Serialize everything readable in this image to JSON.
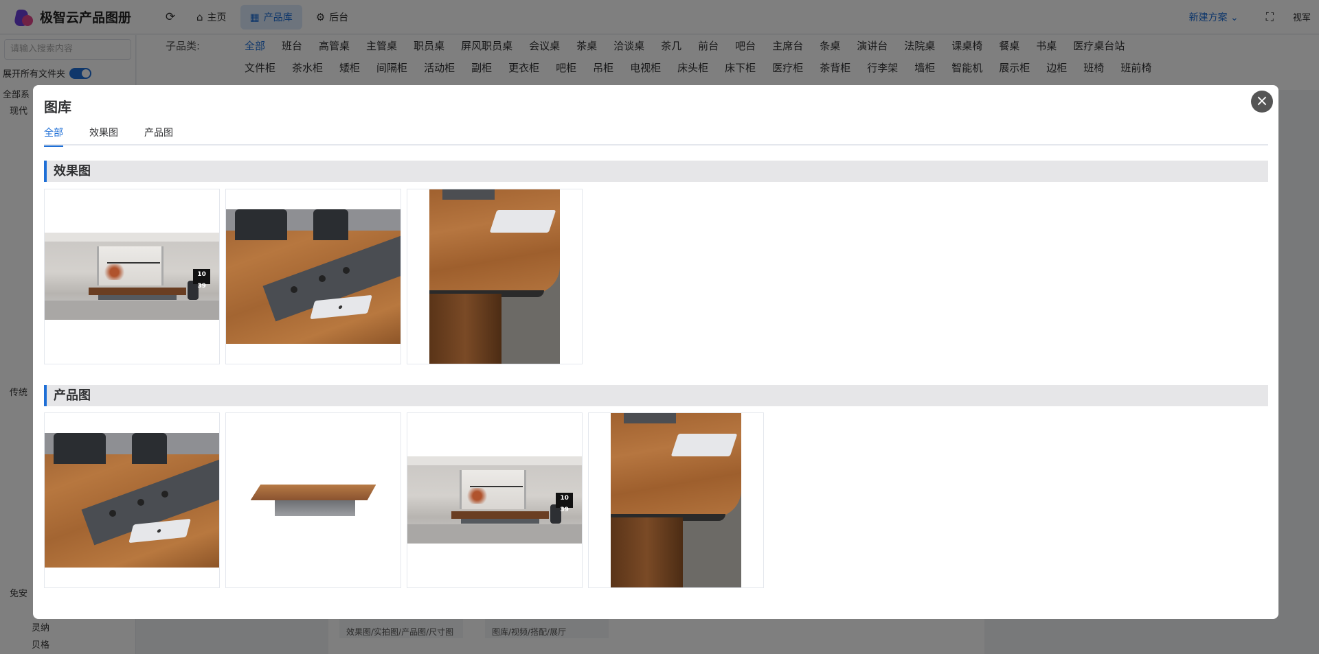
{
  "app": {
    "name": "极智云产品图册",
    "nav": {
      "home": "主页",
      "library": "产品库",
      "backend": "后台"
    },
    "new_plan": "新建方案",
    "user": "视军"
  },
  "sidebar": {
    "search_placeholder": "请输入搜索内容",
    "expand_label": "展开所有文件夹",
    "items": [
      "全部系",
      "现代",
      "传统",
      "免安",
      "灵纳",
      "贝格"
    ]
  },
  "filters": {
    "label": "子品类:",
    "row1": [
      "全部",
      "班台",
      "高管桌",
      "主管桌",
      "职员桌",
      "屏风职员桌",
      "会议桌",
      "茶桌",
      "洽谈桌",
      "茶几",
      "前台",
      "吧台",
      "主席台",
      "条桌",
      "演讲台",
      "法院桌",
      "课桌椅",
      "餐桌",
      "书桌",
      "医疗桌台站"
    ],
    "row2": [
      "文件柜",
      "茶水柜",
      "矮柜",
      "间隔柜",
      "活动柜",
      "副柜",
      "更衣柜",
      "吧柜",
      "吊柜",
      "电视柜",
      "床头柜",
      "床下柜",
      "医疗柜",
      "茶背柜",
      "行李架",
      "墙柜",
      "智能机",
      "展示柜",
      "边柜",
      "班椅",
      "班前椅"
    ]
  },
  "card_tags": [
    "效果图/实拍图/产品图/尺寸图",
    "图库/视频/搭配/展厅"
  ],
  "dialog": {
    "title": "图库",
    "close_icon": "close-icon",
    "tabs": [
      "全部",
      "效果图",
      "产品图"
    ],
    "active_tab": "全部",
    "sections": [
      {
        "title": "效果图",
        "images": [
          "meeting-room",
          "desk-closeup",
          "corner-closeup"
        ]
      },
      {
        "title": "产品图",
        "images": [
          "desk-closeup",
          "product-table",
          "meeting-room",
          "corner-closeup"
        ]
      }
    ],
    "tv_clock": "10 39"
  },
  "colors": {
    "accent": "#1f6fd6",
    "section_bg": "#e6e6e8"
  }
}
